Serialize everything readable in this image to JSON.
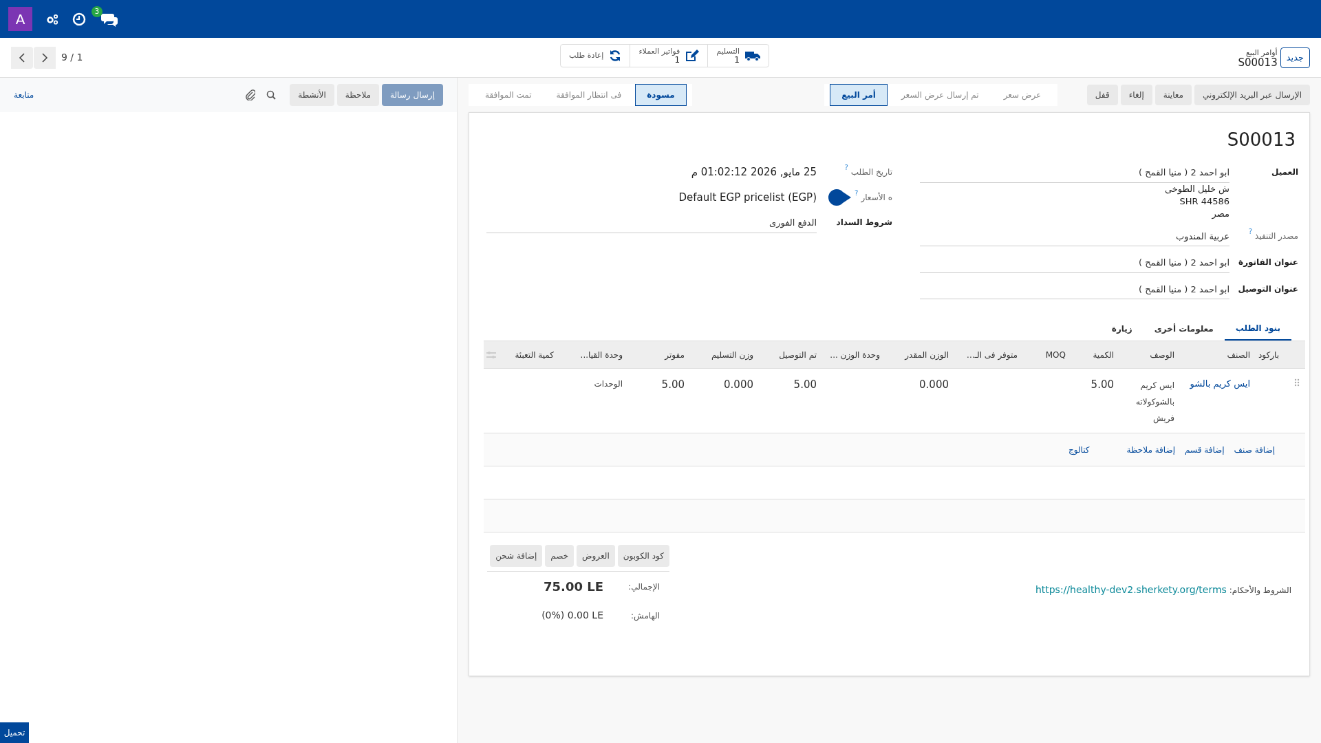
{
  "navbar": {
    "avatar": "A",
    "chat_badge": "3"
  },
  "control_panel": {
    "new_button": "جديد",
    "breadcrumb_parent": "أوامر البيع",
    "breadcrumb_current": "S00013",
    "smart_buttons": [
      {
        "kind": "truck",
        "label": "التسليم",
        "count": "1"
      },
      {
        "kind": "edit",
        "label": "فواتير العملاء",
        "count": "1"
      },
      {
        "kind": "refresh",
        "label": "إعادة طلب"
      }
    ],
    "pager": "9 / 1"
  },
  "action_buttons": [
    "الإرسال عبر البريد الإلكتروني",
    "معاينة",
    "إلغاء",
    "قفل"
  ],
  "statusbars": [
    [
      {
        "label": "عرض سعر",
        "selected": false
      },
      {
        "label": "تم إرسال عرض السعر",
        "selected": false
      },
      {
        "label": "أمر البيع",
        "selected": true
      }
    ],
    [
      {
        "label": "مسودة",
        "selected": true
      },
      {
        "label": "فى انتظار الموافقة",
        "selected": false
      },
      {
        "label": "تمت الموافقة",
        "selected": false
      }
    ]
  ],
  "chatter": {
    "buttons": [
      {
        "label": "إرسال رسالة",
        "kind": "primary"
      },
      {
        "label": "ملاحظة",
        "kind": "secondary"
      },
      {
        "label": "الأنشطة",
        "kind": "secondary"
      }
    ],
    "follow": "متابعة"
  },
  "form": {
    "title": "S00013",
    "right_fields": [
      {
        "label": "العميل",
        "value": "ابو احمد 2 ( منيا القمح )",
        "kind": "input",
        "address": [
          "ش خليل الطوخى",
          "SHR 44586",
          "مصر"
        ]
      },
      {
        "label": "مصدر التنفيذ",
        "help": "?",
        "value": "عربية المندوب",
        "kind": "input"
      },
      {
        "label": "عنوان الفاتورة",
        "value": "ابو احمد 2 ( منيا القمح )",
        "kind": "input"
      },
      {
        "label": "عنوان التوصيل",
        "value": "ابو احمد 2 ( منيا القمح )",
        "kind": "input"
      }
    ],
    "left_fields": [
      {
        "label": "تاريخ الطلب",
        "help": "?",
        "value": "25 مايو, 2026 01:02:12 م",
        "kind": "readonly"
      },
      {
        "label": "ه الأسعار",
        "help": "?",
        "value": "Default EGP pricelist (EGP)",
        "kind": "readonly",
        "marker": true
      },
      {
        "label": "شروط السداد",
        "value": "الدفع الفورى",
        "kind": "input"
      }
    ]
  },
  "tabs": [
    {
      "label": "بنود الطلب",
      "selected": true
    },
    {
      "label": "معلومات أخرى",
      "selected": false
    },
    {
      "label": "زيارة",
      "selected": false
    }
  ],
  "table": {
    "columns": [
      "باركود",
      "الصنف",
      "الوصف",
      "الكمية",
      "MOQ",
      "متوفر فى الـ...",
      "الوزن المقدر",
      "وحدة الوزن ...",
      "تم التوصيل",
      "وزن التسليم",
      "مفوتر",
      "وحدة القيا...",
      "كمية التعبئة"
    ],
    "rows": [
      {
        "cells": [
          null,
          "ايس كريم بالشو",
          "ايس كريم بالشوكولاته فريش",
          "5.00",
          null,
          null,
          "0.000",
          null,
          "5.00",
          "0.000",
          "5.00",
          "الوحدات",
          null
        ]
      }
    ],
    "add_links": [
      "إضافة صنف",
      "إضافة قسم",
      "إضافة ملاحظة",
      "كتالوج"
    ]
  },
  "footer": {
    "terms_label": "الشروط والأحكام:",
    "terms_link": "https://healthy-dev2.sherkety.org/terms",
    "buttons": [
      "كود الكوبون",
      "العروض",
      "خصم",
      "إضافة شحن"
    ],
    "totals": [
      {
        "kind": "total",
        "label": "الإجمالي:",
        "value": "75.00 LE"
      },
      {
        "kind": "margin",
        "label": "الهامش:",
        "value": "(0%) 0.00 LE"
      }
    ]
  },
  "download_button": "تحميل"
}
